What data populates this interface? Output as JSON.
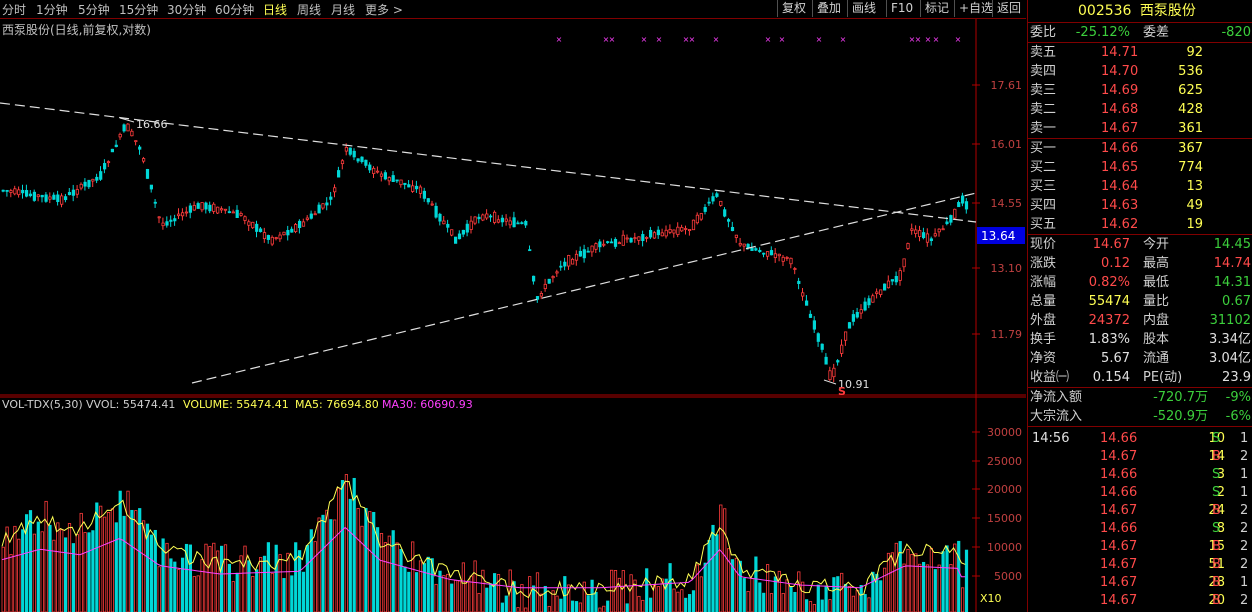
{
  "toolbar": {
    "periods": [
      "分时",
      "1分钟",
      "5分钟",
      "15分钟",
      "30分钟",
      "60分钟",
      "日线",
      "周线",
      "月线",
      "更多 >"
    ],
    "active_period": "日线",
    "buttons": [
      "复权",
      "叠加",
      "画线",
      "F10",
      "标记",
      "+自选",
      "返回"
    ]
  },
  "chart": {
    "title": "西泵股份(日线,前复权,对数)",
    "price_ticks": [
      "17.61",
      "16.01",
      "14.55",
      "13.10",
      "11.79"
    ],
    "current_price_tag": "13.64",
    "high_label": "16.66",
    "low_label": "10.91",
    "signal_label": "S",
    "volume_legend": {
      "indicator": "VOL-TDX(5,30)",
      "vvol": "VVOL: 55474.41",
      "volume": "VOLUME: 55474.41",
      "ma5": "MA5: 76694.80",
      "ma30": "MA30: 60690.93"
    },
    "volume_ticks": [
      "30000",
      "25000",
      "20000",
      "15000",
      "10000",
      "5000"
    ],
    "volume_unit": "X10",
    "colors": {
      "up": "#ff3c3c",
      "down": "#00d7d7",
      "ma5": "#ffff54",
      "ma30": "#ff40ff",
      "axis": "#b00000"
    }
  },
  "quote": {
    "code": "002536",
    "name": "西泵股份",
    "weibi_label": "委比",
    "weibi": "-25.12%",
    "weicha_label": "委差",
    "weicha": "-820",
    "asks": [
      {
        "label": "卖五",
        "price": "14.71",
        "vol": "92"
      },
      {
        "label": "卖四",
        "price": "14.70",
        "vol": "536"
      },
      {
        "label": "卖三",
        "price": "14.69",
        "vol": "625"
      },
      {
        "label": "卖二",
        "price": "14.68",
        "vol": "428"
      },
      {
        "label": "卖一",
        "price": "14.67",
        "vol": "361"
      }
    ],
    "bids": [
      {
        "label": "买一",
        "price": "14.66",
        "vol": "367"
      },
      {
        "label": "买二",
        "price": "14.65",
        "vol": "774"
      },
      {
        "label": "买三",
        "price": "14.64",
        "vol": "13"
      },
      {
        "label": "买四",
        "price": "14.63",
        "vol": "49"
      },
      {
        "label": "买五",
        "price": "14.62",
        "vol": "19"
      }
    ],
    "stats": [
      {
        "l1": "现价",
        "v1": "14.67",
        "c1": "red",
        "l2": "今开",
        "v2": "14.45",
        "c2": "green"
      },
      {
        "l1": "涨跌",
        "v1": "0.12",
        "c1": "red",
        "l2": "最高",
        "v2": "14.74",
        "c2": "red"
      },
      {
        "l1": "涨幅",
        "v1": "0.82%",
        "c1": "red",
        "l2": "最低",
        "v2": "14.31",
        "c2": "green"
      },
      {
        "l1": "总量",
        "v1": "55474",
        "c1": "yellow",
        "l2": "量比",
        "v2": "0.67",
        "c2": "green"
      },
      {
        "l1": "外盘",
        "v1": "24372",
        "c1": "red",
        "l2": "内盘",
        "v2": "31102",
        "c2": "green"
      },
      {
        "l1": "换手",
        "v1": "1.83%",
        "c1": "white",
        "l2": "股本",
        "v2": "3.34亿",
        "c2": "white"
      },
      {
        "l1": "净资",
        "v1": "5.67",
        "c1": "white",
        "l2": "流通",
        "v2": "3.04亿",
        "c2": "white"
      },
      {
        "l1": "收益㈠",
        "v1": "0.154",
        "c1": "white",
        "l2": "PE(动)",
        "v2": "23.9",
        "c2": "white"
      }
    ],
    "flows": [
      {
        "label": "净流入额",
        "value": "-720.7万",
        "pct": "-9%"
      },
      {
        "label": "大宗流入",
        "value": "-520.9万",
        "pct": "-6%"
      }
    ],
    "ticks": [
      {
        "time": "14:56",
        "price": "14.66",
        "vol": "10",
        "bs": "S",
        "n": "1"
      },
      {
        "time": "",
        "price": "14.67",
        "vol": "14",
        "bs": "B",
        "n": "2"
      },
      {
        "time": "",
        "price": "14.66",
        "vol": "3",
        "bs": "S",
        "n": "1"
      },
      {
        "time": "",
        "price": "14.66",
        "vol": "2",
        "bs": "S",
        "n": "1"
      },
      {
        "time": "",
        "price": "14.67",
        "vol": "24",
        "bs": "B",
        "n": "2"
      },
      {
        "time": "",
        "price": "14.66",
        "vol": "8",
        "bs": "S",
        "n": "2"
      },
      {
        "time": "",
        "price": "14.67",
        "vol": "15",
        "bs": "B",
        "n": "2"
      },
      {
        "time": "",
        "price": "14.67",
        "vol": "51",
        "bs": "B",
        "n": "2"
      },
      {
        "time": "",
        "price": "14.67",
        "vol": "28",
        "bs": "B",
        "n": "1"
      },
      {
        "time": "",
        "price": "14.67",
        "vol": "20",
        "bs": "B",
        "n": "2"
      }
    ]
  }
}
